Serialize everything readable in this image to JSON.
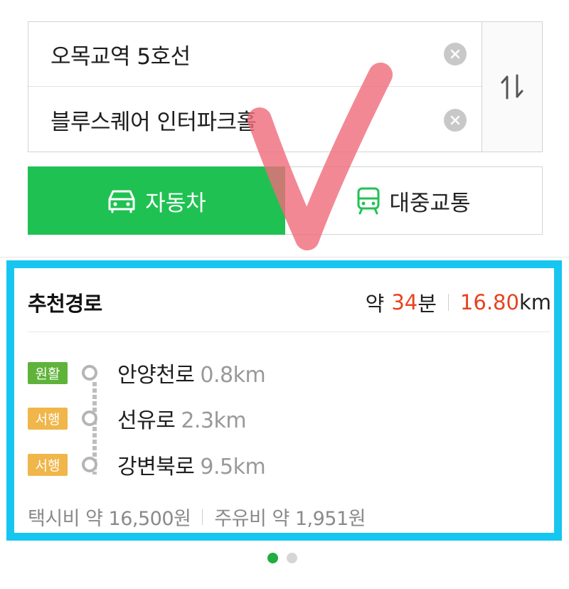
{
  "search": {
    "origin": "오목교역 5호선",
    "destination": "블루스퀘어 인터파크홀"
  },
  "icons": {
    "clear": "clear-icon",
    "swap": "swap-arrows-icon",
    "car": "car-icon",
    "bus": "bus-icon"
  },
  "modes": {
    "car_label": "자동차",
    "transit_label": "대중교통"
  },
  "route": {
    "title": "추천경로",
    "time_prefix": "약",
    "time_value": "34",
    "time_unit": "분",
    "distance_value": "16.80",
    "distance_unit": "km",
    "steps": [
      {
        "status": "원활",
        "road": "안양천로",
        "distance": "0.8km"
      },
      {
        "status": "서행",
        "road": "선유로",
        "distance": "2.3km"
      },
      {
        "status": "서행",
        "road": "강변북로",
        "distance": "9.5km"
      }
    ],
    "taxi_fee": "택시비 약 16,500원",
    "fuel_fee": "주유비 약 1,951원"
  },
  "colors": {
    "accent_green": "#1fc252",
    "highlight_blue": "#16c6f1",
    "value_red": "#e8421f",
    "smooth_badge": "#5fb33a",
    "slow_badge": "#f0b64a",
    "checkmark": "#f06a7a"
  },
  "pager": {
    "total": 2,
    "active": 1
  }
}
